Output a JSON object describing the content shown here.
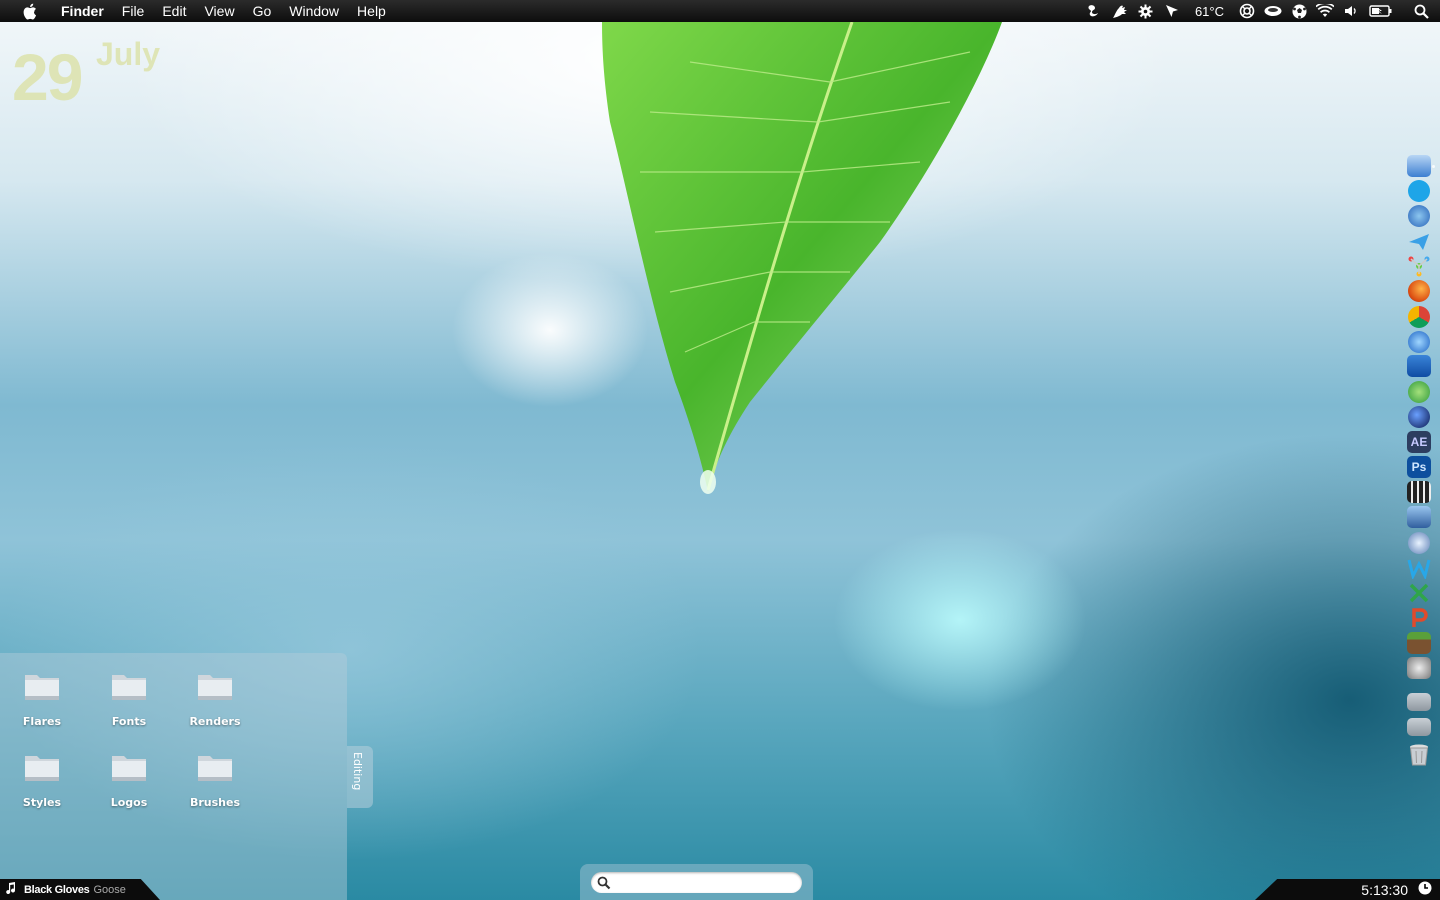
{
  "menubar": {
    "apple_icon": "apple-icon",
    "items": [
      "Finder",
      "File",
      "Edit",
      "View",
      "Go",
      "Window",
      "Help"
    ],
    "temperature": "61°C",
    "status_icons": [
      "fan-icon",
      "growl-icon",
      "gear-icon",
      "cursor-icon",
      "temperature-readout",
      "lifebuoy-icon",
      "drive-icon",
      "soccer-ball-icon",
      "wifi-icon",
      "volume-icon",
      "battery-icon",
      "spotlight-icon"
    ]
  },
  "date_widget": {
    "day": "29",
    "month": "July"
  },
  "stack": {
    "tab_label": "Editing",
    "folders": [
      {
        "label": "Flares"
      },
      {
        "label": "Fonts"
      },
      {
        "label": "Renders"
      },
      {
        "label": "Styles"
      },
      {
        "label": "Logos"
      },
      {
        "label": "Brushes"
      }
    ]
  },
  "dock": {
    "items": [
      "finder-icon",
      "skype-icon",
      "app-store-icon",
      "mail-icon",
      "network-icon",
      "firefox-icon",
      "chrome-icon",
      "itunes-icon",
      "cyberduck-icon",
      "utorrent-icon",
      "cinema4d-icon",
      "after-effects-icon",
      "photoshop-icon",
      "final-cut-icon",
      "imovie-icon",
      "safari-icon",
      "dreamweaver-icon",
      "excel-icon",
      "powerpoint-icon",
      "minecraft-icon",
      "system-preferences-icon",
      "applications-folder-icon",
      "downloads-folder-icon",
      "trash-icon"
    ],
    "labels": {
      "ae": "AE",
      "ps": "Ps"
    }
  },
  "now_playing": {
    "track": "Black Gloves",
    "artist": "Goose"
  },
  "clock": {
    "time": "5:13:30"
  },
  "search": {
    "placeholder": ""
  },
  "colors": {
    "menubar": "#111111",
    "date_text": "#dce2aa",
    "leaf": "#5cc43a"
  }
}
